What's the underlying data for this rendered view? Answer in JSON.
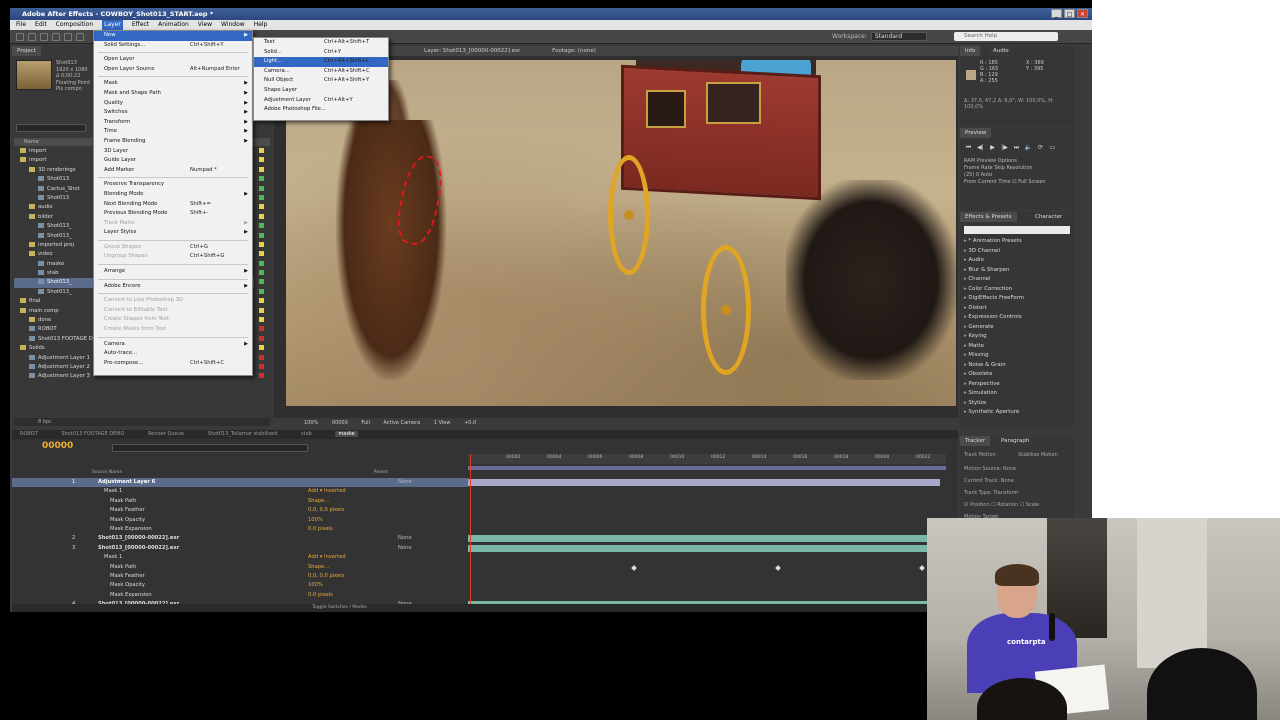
{
  "window": {
    "title": "Adobe After Effects - COWBOY_Shot013_START.aep *",
    "buttons": [
      "_",
      "□",
      "✕"
    ]
  },
  "menubar": [
    "File",
    "Edit",
    "Composition",
    "Layer",
    "Effect",
    "Animation",
    "View",
    "Window",
    "Help"
  ],
  "toolbar": {
    "workspace_label": "Workspace:",
    "workspace_value": "Standard",
    "search_placeholder": "Search Help"
  },
  "layer_menu": [
    {
      "label": "New",
      "shortcut": "",
      "submenu": true,
      "state": "highlighted"
    },
    {
      "label": "Solid Settings...",
      "shortcut": "Ctrl+Shift+Y"
    },
    {
      "sep": true
    },
    {
      "label": "Open Layer",
      "shortcut": ""
    },
    {
      "label": "Open Layer Source",
      "shortcut": "Alt+Numpad Enter"
    },
    {
      "sep": true
    },
    {
      "label": "Mask",
      "submenu": true
    },
    {
      "label": "Mask and Shape Path",
      "submenu": true
    },
    {
      "label": "Quality",
      "submenu": true
    },
    {
      "label": "Switches",
      "submenu": true
    },
    {
      "label": "Transform",
      "submenu": true
    },
    {
      "label": "Time",
      "submenu": true
    },
    {
      "label": "Frame Blending",
      "submenu": true
    },
    {
      "label": "3D Layer"
    },
    {
      "label": "Guide Layer"
    },
    {
      "label": "Add Marker",
      "shortcut": "Numpad *"
    },
    {
      "sep": true
    },
    {
      "label": "Preserve Transparency"
    },
    {
      "label": "Blending Mode",
      "submenu": true
    },
    {
      "label": "Next Blending Mode",
      "shortcut": "Shift+="
    },
    {
      "label": "Previous Blending Mode",
      "shortcut": "Shift+-"
    },
    {
      "label": "Track Matte",
      "submenu": true,
      "state": "disabled"
    },
    {
      "label": "Layer Styles",
      "submenu": true
    },
    {
      "sep": true
    },
    {
      "label": "Group Shapes",
      "shortcut": "Ctrl+G",
      "state": "disabled"
    },
    {
      "label": "Ungroup Shapes",
      "shortcut": "Ctrl+Shift+G",
      "state": "disabled"
    },
    {
      "sep": true
    },
    {
      "label": "Arrange",
      "submenu": true
    },
    {
      "sep": true
    },
    {
      "label": "Adobe Encore",
      "submenu": true
    },
    {
      "sep": true
    },
    {
      "label": "Convert to Live Photoshop 3D",
      "state": "disabled"
    },
    {
      "label": "Convert to Editable Text",
      "state": "disabled"
    },
    {
      "label": "Create Shapes from Text",
      "state": "disabled"
    },
    {
      "label": "Create Masks from Text",
      "state": "disabled"
    },
    {
      "sep": true
    },
    {
      "label": "Camera",
      "submenu": true
    },
    {
      "label": "Auto-trace..."
    },
    {
      "label": "Pre-compose...",
      "shortcut": "Ctrl+Shift+C"
    }
  ],
  "new_submenu": [
    {
      "label": "Text",
      "shortcut": "Ctrl+Alt+Shift+T"
    },
    {
      "label": "Solid...",
      "shortcut": "Ctrl+Y"
    },
    {
      "label": "Light...",
      "shortcut": "Ctrl+Alt+Shift+L",
      "state": "highlighted"
    },
    {
      "label": "Camera...",
      "shortcut": "Ctrl+Alt+Shift+C"
    },
    {
      "label": "Null Object",
      "shortcut": "Ctrl+Alt+Shift+Y"
    },
    {
      "label": "Shape Layer",
      "shortcut": ""
    },
    {
      "label": "Adjustment Layer",
      "shortcut": "Ctrl+Alt+Y"
    },
    {
      "label": "Adobe Photoshop File...",
      "shortcut": ""
    }
  ],
  "project": {
    "tab": "Project",
    "item_name": "Shot013",
    "item_info": [
      "1920 x 1080",
      "Δ 0;00:22",
      "Floating Point",
      "Pix compo"
    ],
    "header": "Name",
    "footer": "8 bpc",
    "rows": [
      {
        "label": "import",
        "indent": 0,
        "color": "#e8d24b"
      },
      {
        "label": "import",
        "indent": 0,
        "color": "#e8d24b"
      },
      {
        "label": "3D renderings",
        "indent": 1,
        "color": "#e8d24b"
      },
      {
        "label": "Shot013",
        "indent": 2,
        "color": "#50b85a"
      },
      {
        "label": "Cactus_Shot",
        "indent": 2,
        "color": "#50b85a"
      },
      {
        "label": "Shot013",
        "indent": 2,
        "color": "#50b85a"
      },
      {
        "label": "audio",
        "indent": 1,
        "color": "#e8d24b"
      },
      {
        "label": "bilder",
        "indent": 1,
        "color": "#e8d24b"
      },
      {
        "label": "Shot013_",
        "indent": 2,
        "color": "#50b85a"
      },
      {
        "label": "Shot013_",
        "indent": 2,
        "color": "#50b85a"
      },
      {
        "label": "imported proj",
        "indent": 1,
        "color": "#e8d24b"
      },
      {
        "label": "video",
        "indent": 1,
        "color": "#e8d24b"
      },
      {
        "label": "maske",
        "indent": 2,
        "color": "#50b85a"
      },
      {
        "label": "stab",
        "indent": 2,
        "color": "#50b85a"
      },
      {
        "label": "Shot013_",
        "indent": 2,
        "color": "#50b85a",
        "selected": true
      },
      {
        "label": "Shot013_",
        "indent": 2,
        "color": "#50b85a"
      },
      {
        "label": "final",
        "indent": 0,
        "color": "#e8d24b"
      },
      {
        "label": "main comp",
        "indent": 0,
        "color": "#e8d24b"
      },
      {
        "label": "done",
        "indent": 1,
        "color": "#e8d24b"
      },
      {
        "label": "ROBOT",
        "indent": 1,
        "color": "#d03030"
      },
      {
        "label": "Shot013 FOOTAGE DEMO",
        "indent": 1,
        "color": "#d03030"
      },
      {
        "label": "Solids",
        "indent": 0,
        "color": "#e8d24b"
      },
      {
        "label": "Adjustment Layer 1",
        "indent": 1,
        "color": "#d03030"
      },
      {
        "label": "Adjustment Layer 2",
        "indent": 1,
        "color": "#d03030"
      },
      {
        "label": "Adjustment Layer 3",
        "indent": 1,
        "color": "#d03030"
      }
    ]
  },
  "viewer": {
    "tabs": [
      "Layer: Shot013_[00000-00022].exr",
      "Footage: (none)"
    ],
    "controls": [
      "100%",
      "00000",
      "Full",
      "Active Camera",
      "1 View",
      "+0.0"
    ]
  },
  "info": {
    "tab": "Info",
    "tab2": "Audio",
    "rgb": [
      "R : 185",
      "G : 165",
      "B : 129",
      "A : 255"
    ],
    "xy": [
      "X : 369",
      "Y : 395"
    ],
    "detail": "Δ: 37,0, 47,2  Δ: 6,0°, W: 100,0%, H: 100,0%"
  },
  "preview": {
    "tab": "Preview",
    "buttons": [
      "⏮",
      "◀|",
      "▶",
      "|▶",
      "⏭",
      "🔈",
      "⟳",
      "▭"
    ],
    "options": [
      "RAM Preview Options",
      "Frame Rate   Skip   Resolution",
      "(25)   0   Auto",
      "From Current Time   ☑ Full Screen"
    ]
  },
  "effects": {
    "tab": "Effects & Presets",
    "tab2": "Character",
    "items": [
      "* Animation Presets",
      "3D Channel",
      "Audio",
      "Blur & Sharpen",
      "Channel",
      "Color Correction",
      "DigiEffects FreeForm",
      "Distort",
      "Expression Controls",
      "Generate",
      "Keying",
      "Matte",
      "Missing",
      "Noise & Grain",
      "Obsolete",
      "Perspective",
      "Simulation",
      "Stylize",
      "Synthetic Aperture"
    ]
  },
  "timeline": {
    "tabs": [
      "ROBOT",
      "Shot013 FOOTAGE DEMO",
      "Render Queue",
      "Shot013_Tollamar stabilized",
      "stab",
      "maske"
    ],
    "active_tab": "maske",
    "timecode": "00000",
    "ruler": [
      "00002",
      "00004",
      "00006",
      "00008",
      "00010",
      "00012",
      "00014",
      "00016",
      "00018",
      "00020",
      "00022"
    ],
    "columns": "Source Name",
    "parent_col": "Parent",
    "footer": "Toggle Switches / Modes",
    "layers": [
      {
        "num": "1",
        "name": "Adjustment Layer 6",
        "val": "",
        "mode": "None",
        "indent": 0,
        "selected": true
      },
      {
        "num": "",
        "name": "Mask 1",
        "val": "Add  ▾   Inverted",
        "mode": "",
        "indent": 1
      },
      {
        "num": "",
        "name": "Mask Path",
        "val": "Shape...",
        "mode": "",
        "indent": 2
      },
      {
        "num": "",
        "name": "Mask Feather",
        "val": "0,0, 0,0 pixels",
        "mode": "",
        "indent": 2
      },
      {
        "num": "",
        "name": "Mask Opacity",
        "val": "100%",
        "mode": "",
        "indent": 2
      },
      {
        "num": "",
        "name": "Mask Expansion",
        "val": "0,0 pixels",
        "mode": "",
        "indent": 2
      },
      {
        "num": "2",
        "name": "Shot013_[00000-00022].exr",
        "val": "",
        "mode": "None",
        "indent": 0
      },
      {
        "num": "3",
        "name": "Shot013_[00000-00022].exr",
        "val": "",
        "mode": "None",
        "indent": 0
      },
      {
        "num": "",
        "name": "Mask 1",
        "val": "Add  ▾   Inverted",
        "mode": "",
        "indent": 1
      },
      {
        "num": "",
        "name": "Mask Path",
        "val": "Shape...",
        "mode": "",
        "indent": 2
      },
      {
        "num": "",
        "name": "Mask Feather",
        "val": "0,0, 0,0 pixels",
        "mode": "",
        "indent": 2
      },
      {
        "num": "",
        "name": "Mask Opacity",
        "val": "100%",
        "mode": "",
        "indent": 2
      },
      {
        "num": "",
        "name": "Mask Expansion",
        "val": "0,0 pixels",
        "mode": "",
        "indent": 2
      },
      {
        "num": "4",
        "name": "Shot013_[00000-00022].exr",
        "val": "",
        "mode": "None",
        "indent": 0
      }
    ]
  },
  "tracker": {
    "tab": "Tracker",
    "tab2": "Paragraph",
    "labels": [
      "Track Motion",
      "Stabilize Motion",
      "Motion Source:  None",
      "Current Track:  None",
      "Track Type:  Transform",
      "☑ Position  ☐ Rotation  ☐ Scale",
      "Motion Target:"
    ]
  },
  "webcam": {
    "shirt_text": "contarpta"
  }
}
